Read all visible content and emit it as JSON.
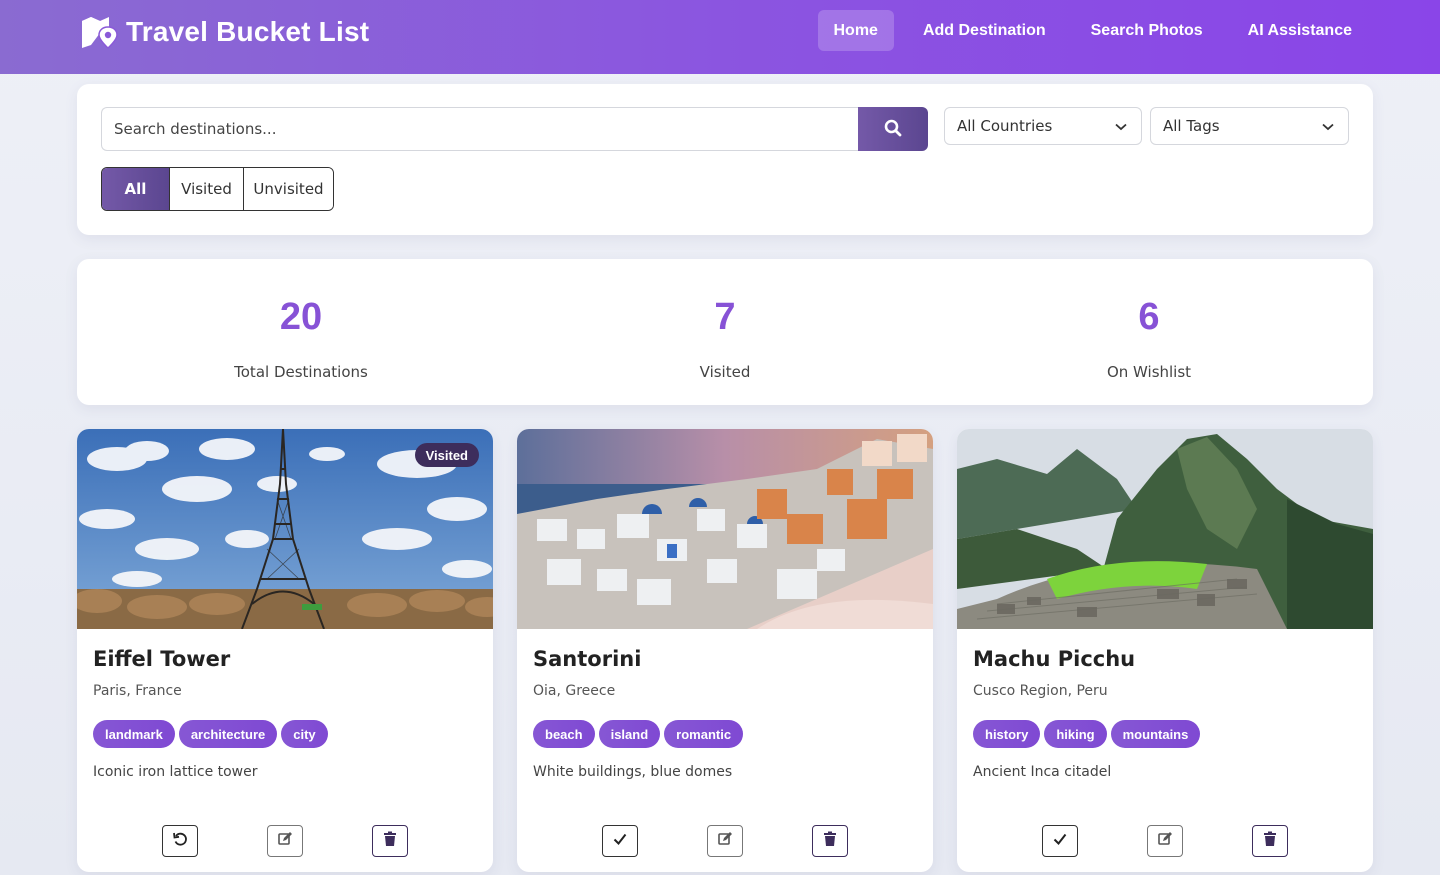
{
  "header": {
    "brand": "Travel Bucket List",
    "nav": [
      {
        "label": "Home",
        "active": true
      },
      {
        "label": "Add Destination"
      },
      {
        "label": "Search Photos"
      },
      {
        "label": "AI Assistance"
      }
    ]
  },
  "filters": {
    "search_placeholder": "Search destinations...",
    "countries": "All Countries",
    "tags": "All Tags",
    "status_options": [
      "All",
      "Visited",
      "Unvisited"
    ],
    "status_selected": "All"
  },
  "stats": [
    {
      "value": "20",
      "label": "Total Destinations"
    },
    {
      "value": "7",
      "label": "Visited"
    },
    {
      "value": "6",
      "label": "On Wishlist"
    }
  ],
  "destinations": [
    {
      "title": "Eiffel Tower",
      "location": "Paris, France",
      "tags": [
        "landmark",
        "architecture",
        "city"
      ],
      "description": "Iconic iron lattice tower",
      "badge": "Visited",
      "visited": true
    },
    {
      "title": "Santorini",
      "location": "Oia, Greece",
      "tags": [
        "beach",
        "island",
        "romantic"
      ],
      "description": "White buildings, blue domes",
      "visited": false
    },
    {
      "title": "Machu Picchu",
      "location": "Cusco Region, Peru",
      "tags": [
        "history",
        "hiking",
        "mountains"
      ],
      "description": "Ancient Inca citadel",
      "visited": false
    }
  ],
  "colors": {
    "header_start": "#8a6bd1",
    "header_end": "#8a45e8",
    "accent": "#8752d6",
    "dark_button": "#3d2d5c"
  }
}
